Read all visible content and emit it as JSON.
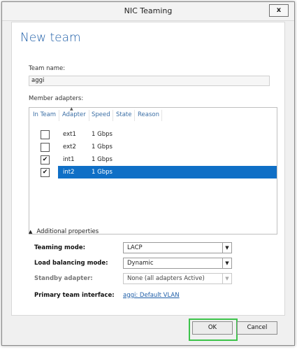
{
  "window": {
    "title": "NIC Teaming",
    "close_label": "x"
  },
  "heading": "New team",
  "team_name": {
    "label": "Team name:",
    "value": "aggi"
  },
  "member_adapters": {
    "label": "Member adapters:",
    "columns": [
      "In Team",
      "Adapter",
      "Speed",
      "State",
      "Reason"
    ],
    "rows": [
      {
        "checked": false,
        "adapter": "ext1",
        "speed": "1 Gbps",
        "state": "",
        "reason": "",
        "selected": false
      },
      {
        "checked": false,
        "adapter": "ext2",
        "speed": "1 Gbps",
        "state": "",
        "reason": "",
        "selected": false
      },
      {
        "checked": true,
        "adapter": "int1",
        "speed": "1 Gbps",
        "state": "",
        "reason": "",
        "selected": false
      },
      {
        "checked": true,
        "adapter": "int2",
        "speed": "1 Gbps",
        "state": "",
        "reason": "",
        "selected": true
      }
    ]
  },
  "additional_properties": {
    "toggle_label": "Additional properties",
    "teaming_mode": {
      "label": "Teaming mode:",
      "value": "LACP"
    },
    "load_balancing_mode": {
      "label": "Load balancing mode:",
      "value": "Dynamic"
    },
    "standby_adapter": {
      "label": "Standby adapter:",
      "value": "None (all adapters Active)"
    },
    "primary_team_interface": {
      "label": "Primary team interface:",
      "link": "aggi: Default VLAN"
    }
  },
  "buttons": {
    "ok": "OK",
    "cancel": "Cancel"
  },
  "colors": {
    "accent": "#1e5ea8",
    "selection": "#0f6fc6",
    "ok_highlight": "#3cc34a"
  }
}
